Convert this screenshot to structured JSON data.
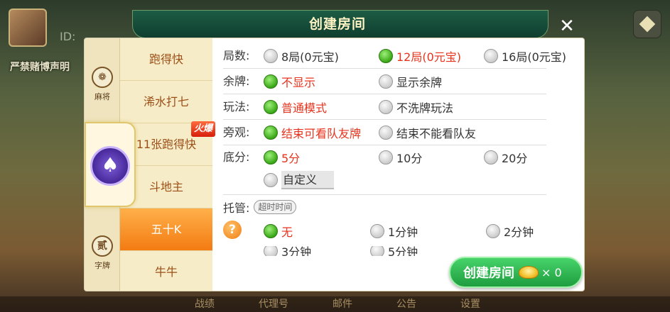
{
  "background": {
    "id_text": "ID:",
    "notice": "严禁赌博声明",
    "bottom_menu": [
      "战绩",
      "代理号",
      "邮件",
      "公告",
      "设置"
    ]
  },
  "dialog": {
    "title": "创建房间",
    "close_icon": "close-icon",
    "side_rail": [
      {
        "icon": "mahjong-icon",
        "label": "麻将"
      },
      {
        "icon": "spade-icon",
        "label": ""
      },
      {
        "icon": "zipai-icon",
        "glyph": "贰",
        "label": "字牌"
      }
    ],
    "games": [
      {
        "label": "跑得快",
        "active": false
      },
      {
        "label": "浠水打七",
        "active": false
      },
      {
        "label": "11张跑得快",
        "active": false,
        "badge": "火爆"
      },
      {
        "label": "斗地主",
        "active": false
      },
      {
        "label": "五十K",
        "active": true
      },
      {
        "label": "牛牛",
        "active": false
      }
    ],
    "settings": {
      "rounds": {
        "label": "局数:",
        "options": [
          "8局(0元宝)",
          "12局(0元宝)",
          "16局(0元宝)"
        ],
        "selected": 1
      },
      "remaining_cards": {
        "label": "余牌:",
        "options": [
          "不显示",
          "显示余牌"
        ],
        "selected": 0
      },
      "mode": {
        "label": "玩法:",
        "options": [
          "普通模式",
          "不洗牌玩法"
        ],
        "selected": 0
      },
      "spectate": {
        "label": "旁观:",
        "options": [
          "结束可看队友牌",
          "结束不能看队友"
        ],
        "selected": 0
      },
      "base_score": {
        "label": "底分:",
        "options": [
          "5分",
          "10分",
          "20分"
        ],
        "selected": 0,
        "custom": "自定义"
      },
      "auto_play": {
        "label": "托管:",
        "tag": "超时时间",
        "options": [
          "无",
          "1分钟",
          "2分钟"
        ],
        "selected": 0,
        "partial_options": [
          "3分钟",
          "5分钟"
        ]
      }
    },
    "create_button": {
      "label": "创建房间",
      "cost_text": "× 0"
    }
  },
  "colors": {
    "selected_text": "#e7331c",
    "active_tab": "#f37b12",
    "button_green": "#2fb64f"
  }
}
